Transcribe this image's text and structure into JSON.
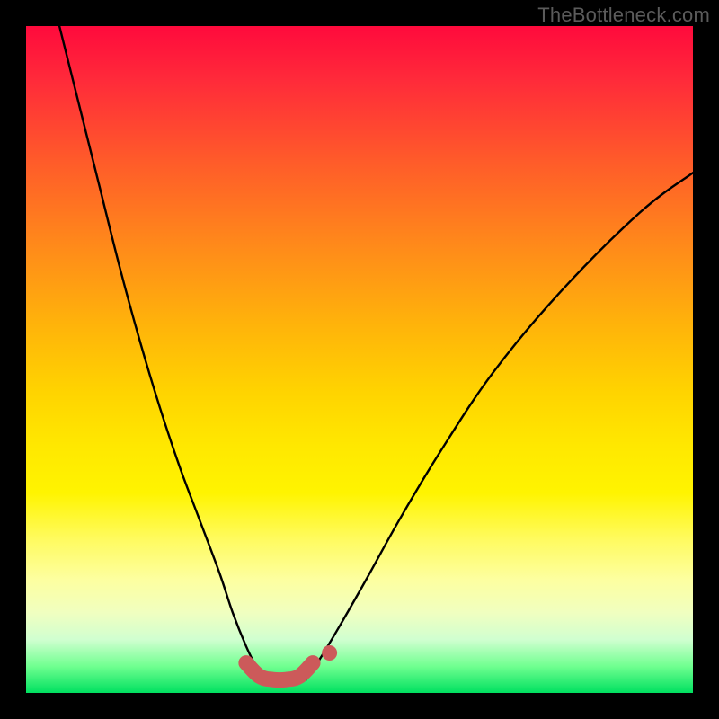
{
  "watermark": "TheBottleneck.com",
  "chart_data": {
    "type": "line",
    "title": "",
    "xlabel": "",
    "ylabel": "",
    "xlim": [
      0,
      100
    ],
    "ylim": [
      0,
      100
    ],
    "series": [
      {
        "name": "left-curve",
        "x": [
          5,
          8,
          11,
          14,
          17,
          20,
          23,
          26,
          29,
          31,
          33,
          34.5,
          36
        ],
        "y": [
          100,
          88,
          76,
          64,
          53,
          43,
          34,
          26,
          18,
          12,
          7,
          4,
          2
        ]
      },
      {
        "name": "right-curve",
        "x": [
          42,
          44,
          47,
          51,
          56,
          62,
          70,
          80,
          92,
          100
        ],
        "y": [
          2,
          5,
          10,
          17,
          26,
          36,
          48,
          60,
          72,
          78
        ]
      },
      {
        "name": "highlight-segment",
        "x": [
          33,
          35,
          37,
          39,
          41,
          43
        ],
        "y": [
          4.5,
          2.5,
          2,
          2,
          2.5,
          4.5
        ]
      }
    ],
    "annotations": [
      {
        "type": "dot",
        "x": 45.5,
        "y": 6.0,
        "color": "#cc5a5a"
      }
    ],
    "background": "rainbow-vertical-gradient"
  }
}
